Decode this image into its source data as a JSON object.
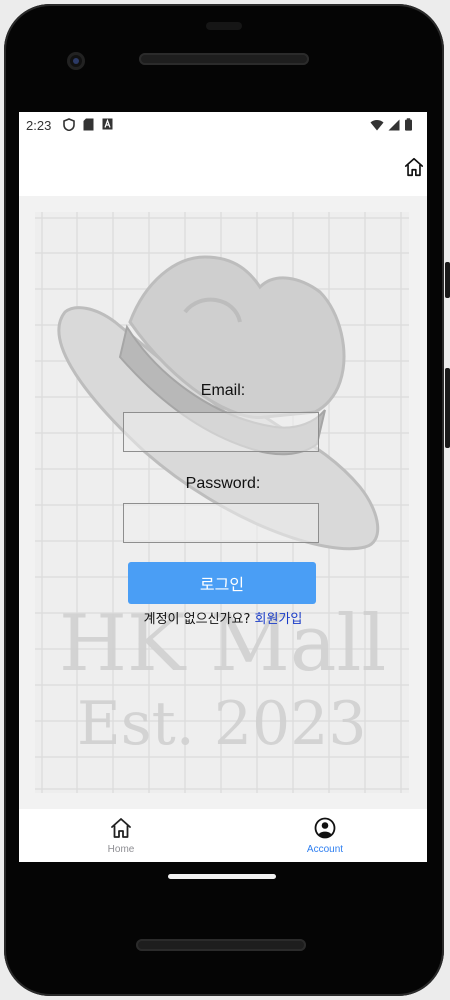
{
  "status_bar": {
    "time": "2:23",
    "left_icons": [
      "shield-icon",
      "sd-card-icon",
      "text-a-icon"
    ],
    "right_icons": [
      "wifi-icon",
      "signal-icon",
      "battery-icon"
    ]
  },
  "header": {
    "home_icon": "home-outline-icon"
  },
  "background": {
    "line1": "HK Mall",
    "line2": "Est. 2023"
  },
  "login_form": {
    "email_label": "Email:",
    "email_value": "",
    "password_label": "Password:",
    "password_value": "",
    "login_button": "로그인",
    "signup_prompt": "계정이 없으신가요? ",
    "signup_link": "회원가입"
  },
  "tab_bar": {
    "tabs": [
      {
        "label": "Home",
        "icon": "home-icon",
        "active": false
      },
      {
        "label": "Account",
        "icon": "account-circle-icon",
        "active": true
      }
    ],
    "active_color": "#2f7ff0",
    "inactive_color": "#8e8e93"
  },
  "colors": {
    "accent": "#4a9ef5",
    "link": "#1a3cc8"
  }
}
